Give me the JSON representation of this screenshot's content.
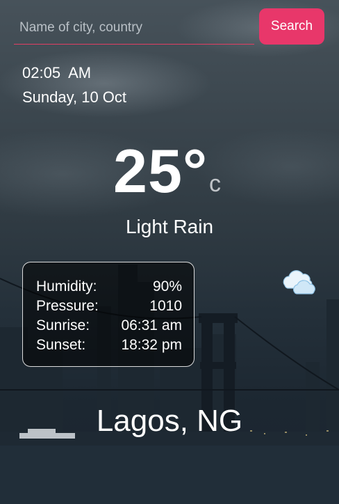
{
  "search": {
    "placeholder": "Name of city, country",
    "button_label": "Search"
  },
  "clock": {
    "time": "02:05  AM",
    "date": "Sunday, 10 Oct"
  },
  "weather": {
    "temperature": "25°",
    "unit": "c",
    "condition": "Light Rain",
    "icon": "cloud-icon"
  },
  "details": {
    "humidity_label": "Humidity:",
    "humidity_value": "90%",
    "pressure_label": "Pressure:",
    "pressure_value": "1010",
    "sunrise_label": "Sunrise:",
    "sunrise_value": "06:31 am",
    "sunset_label": "Sunset:",
    "sunset_value": "18:32 pm"
  },
  "location": {
    "city": "Lagos, NG"
  },
  "colors": {
    "accent": "#e8376a",
    "underline": "#e23e63",
    "text": "#ffffff"
  }
}
